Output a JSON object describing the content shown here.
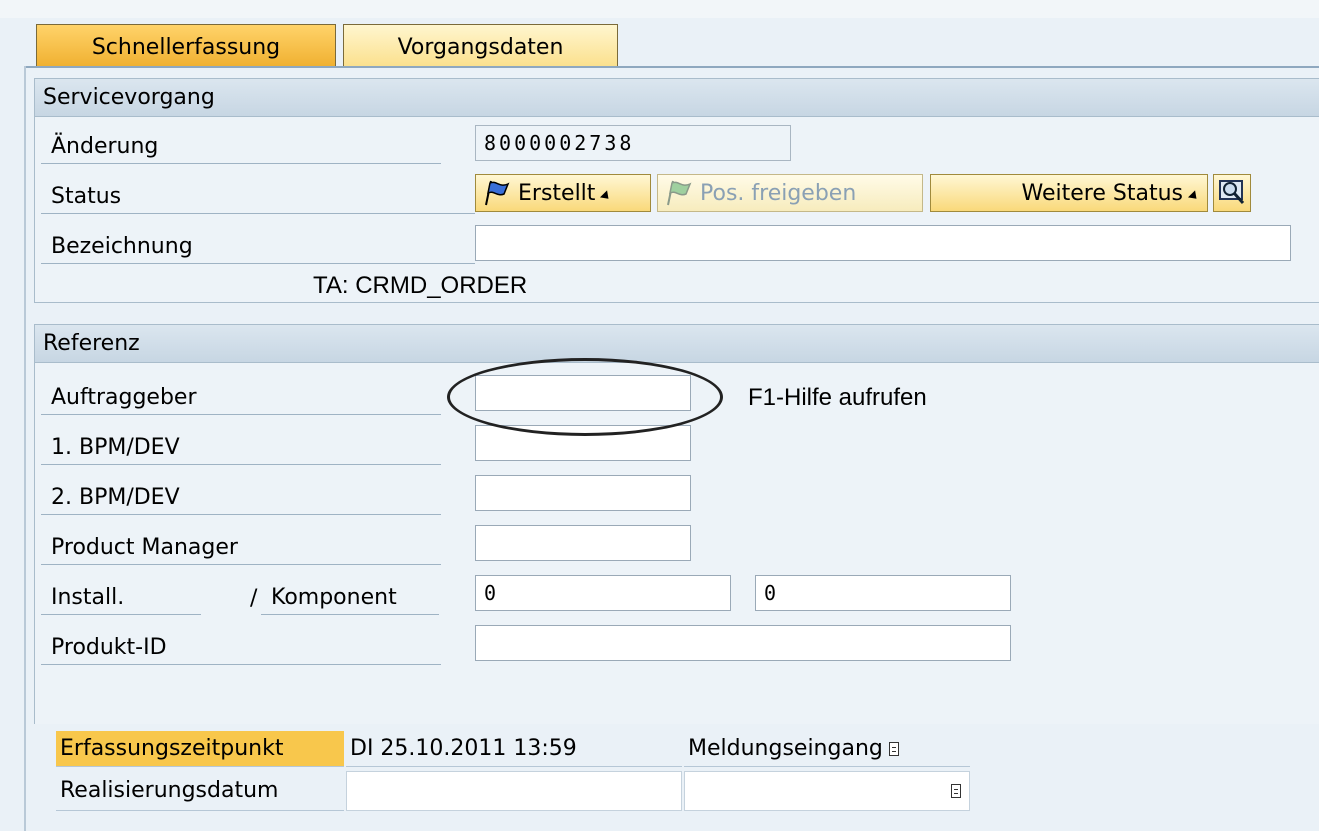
{
  "tabs": [
    {
      "label": "Schnellerfassung",
      "active": true
    },
    {
      "label": "Vorgangsdaten",
      "active": false
    }
  ],
  "servicevorgang": {
    "title": "Servicevorgang",
    "aenderung_label": "Änderung",
    "aenderung_value": "8000002738",
    "status_label": "Status",
    "status_buttons": {
      "erstellt": "Erstellt",
      "pos_freigeben": "Pos. freigeben",
      "weitere_status": "Weitere Status"
    },
    "bezeichnung_label": "Bezeichnung",
    "bezeichnung_value": "",
    "ta_text": "TA: CRMD_ORDER"
  },
  "referenz": {
    "title": "Referenz",
    "auftraggeber_label": "Auftraggeber",
    "auftraggeber_value": "",
    "annotation": "F1-Hilfe aufrufen",
    "bpm1_label": "1. BPM/DEV",
    "bpm2_label": "2. BPM/DEV",
    "product_manager_label": "Product Manager",
    "install_label": "Install.",
    "slash": "/",
    "komponent_label": "Komponent",
    "install_value": "0",
    "komponent_value": "0",
    "produkt_id_label": "Produkt-ID",
    "produkt_id_value": ""
  },
  "dates": {
    "erfassung_label": "Erfassungszeitpunkt",
    "erfassung_value": "DI 25.10.2011 13:59",
    "meldungseingang_label": "Meldungseingang",
    "realisierung_label": "Realisierungsdatum"
  },
  "colors": {
    "tab_active": "#f6c24a",
    "highlight": "#f8c74c",
    "panel": "#edf3f8",
    "header": "#c7d6e3"
  }
}
